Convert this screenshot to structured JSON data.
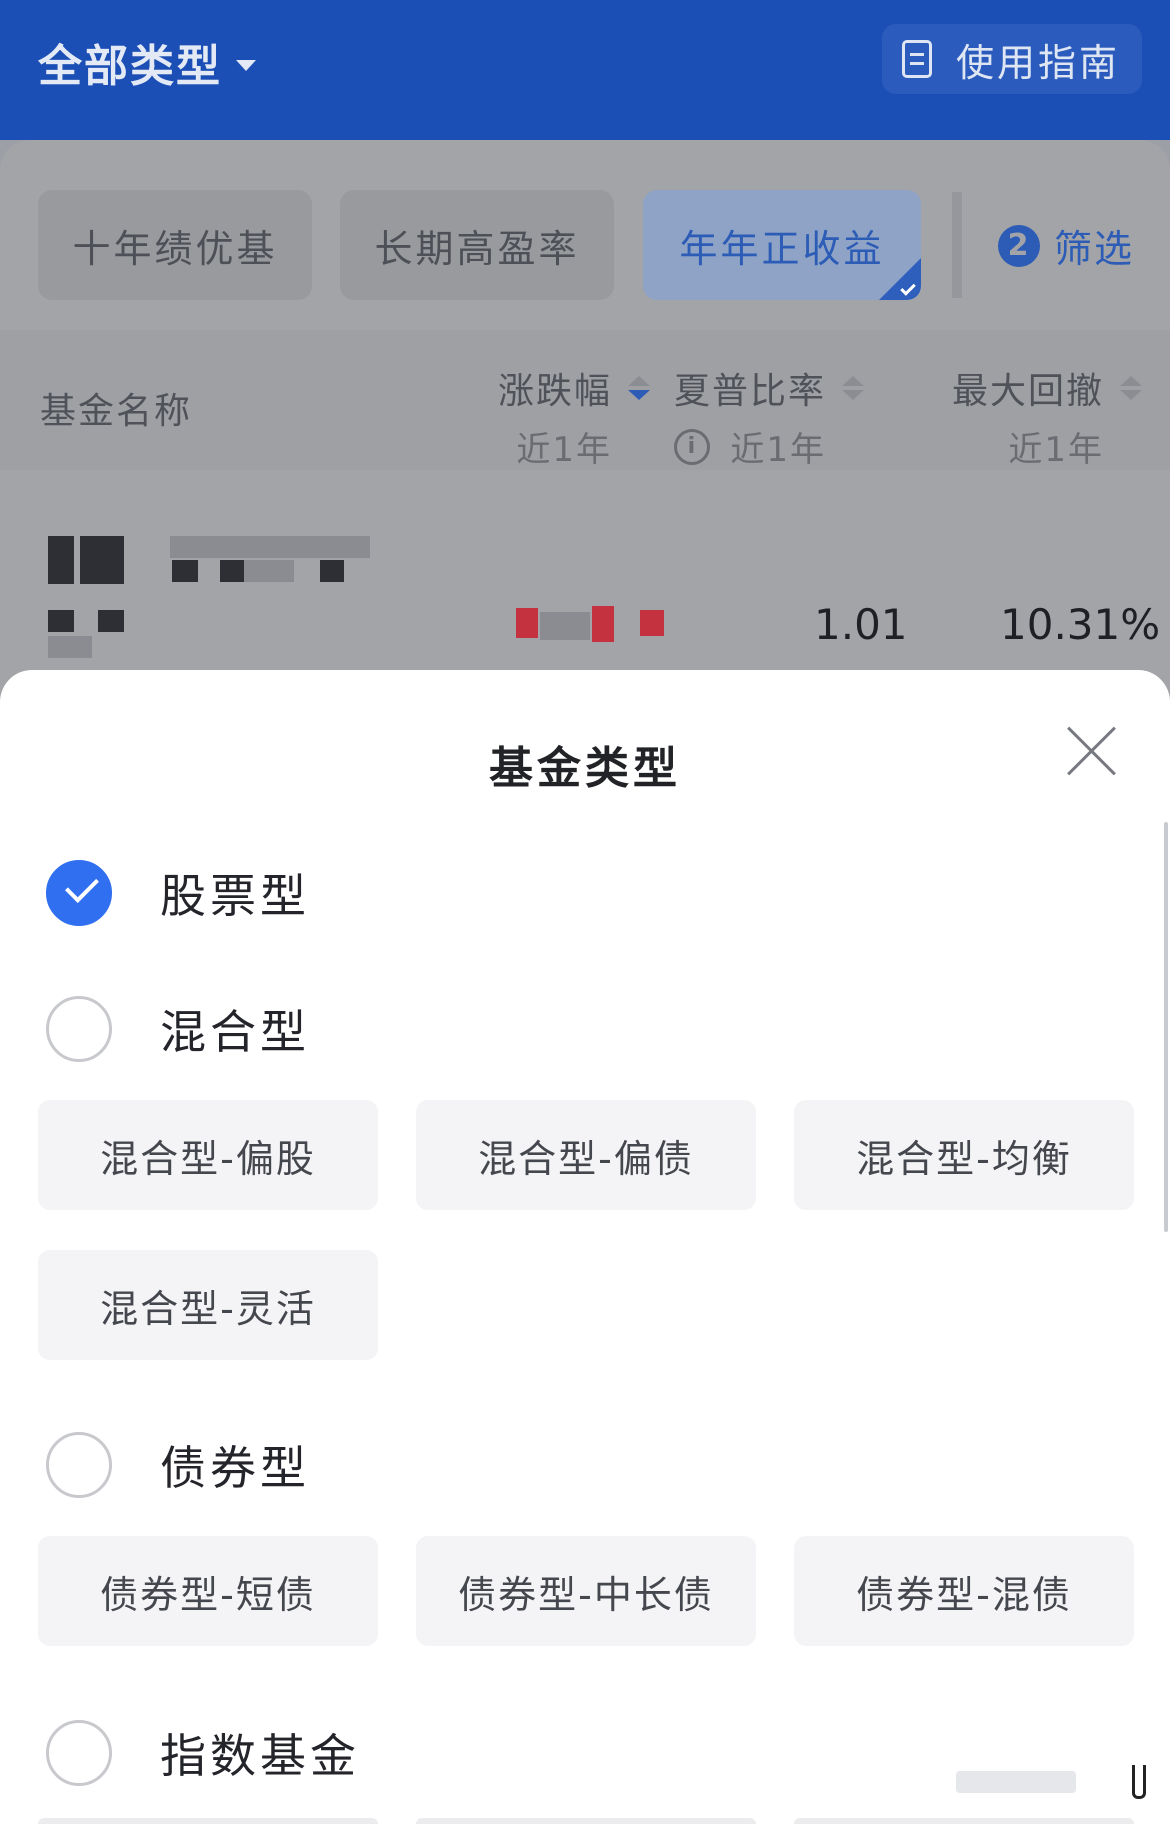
{
  "topbar": {
    "type_selector_label": "全部类型",
    "guide_label": "使用指南"
  },
  "chips": [
    {
      "label": "十年绩优基",
      "active": false
    },
    {
      "label": "长期高盈率",
      "active": false
    },
    {
      "label": "年年正收益",
      "active": true
    }
  ],
  "filter": {
    "count": "2",
    "label": "筛选"
  },
  "table_header": {
    "name": "基金名称",
    "cols": [
      {
        "title": "涨跌幅",
        "sub": "近1年",
        "sort": "desc"
      },
      {
        "title": "夏普比率",
        "sub": "近1年",
        "sort": "none",
        "info": "i"
      },
      {
        "title": "最大回撤",
        "sub": "近1年",
        "sort": "none"
      }
    ]
  },
  "fund_row": {
    "sharpe": "1.01",
    "max_drawdown": "10.31%"
  },
  "sheet": {
    "title": "基金类型",
    "groups": [
      {
        "label": "股票型",
        "checked": true,
        "subs": []
      },
      {
        "label": "混合型",
        "checked": false,
        "subs": [
          "混合型-偏股",
          "混合型-偏债",
          "混合型-均衡",
          "混合型-灵活"
        ]
      },
      {
        "label": "债券型",
        "checked": false,
        "subs": [
          "债券型-短债",
          "债券型-中长债",
          "债券型-混债"
        ]
      },
      {
        "label": "指数基金",
        "checked": false,
        "subs": []
      }
    ]
  },
  "colors": {
    "brand_blue": "#1c4fb5",
    "check_blue": "#2f6ff0",
    "gain_red": "#c4313f"
  }
}
